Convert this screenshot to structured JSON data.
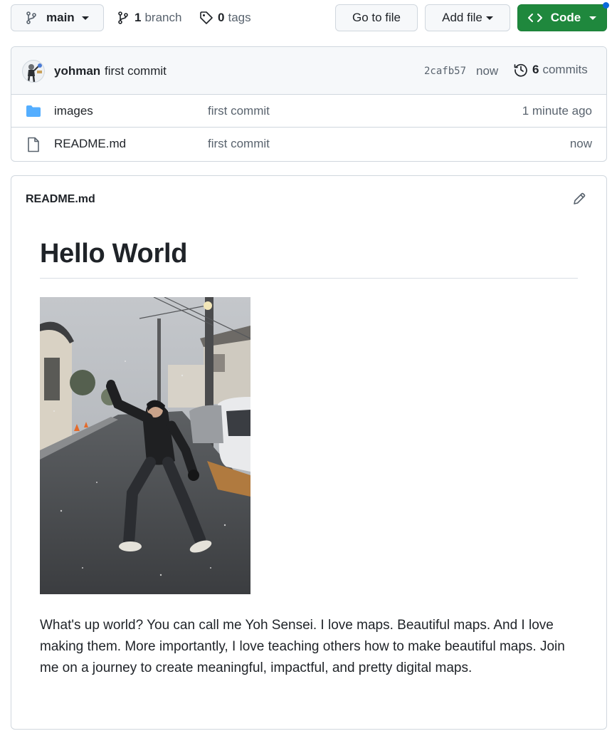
{
  "toolbar": {
    "branch_label": "main",
    "branch_count": "1",
    "branch_word": "branch",
    "tag_count": "0",
    "tag_word": "tags",
    "go_to_file": "Go to file",
    "add_file": "Add file",
    "code": "Code"
  },
  "commit": {
    "author": "yohman",
    "message": "first commit",
    "sha": "2cafb57",
    "time": "now",
    "count": "6",
    "count_word": "commits"
  },
  "files": [
    {
      "type": "folder",
      "name": "images",
      "message": "first commit",
      "age": "1 minute ago"
    },
    {
      "type": "file",
      "name": "README.md",
      "message": "first commit",
      "age": "now"
    }
  ],
  "readme": {
    "file_title": "README.md",
    "heading": "Hello World",
    "paragraph": "What's up world? You can call me Yoh Sensei. I love maps. Beautiful maps. And I love making them. More importantly, I love teaching others how to make beautiful maps. Join me on a journey to create meaningful, impactful, and pretty digital maps."
  },
  "colors": {
    "code_button": "#1f883d",
    "folder_icon": "#54aeff",
    "notification_dot": "#0969da"
  },
  "icons": [
    "branch-icon",
    "tag-icon",
    "code-icon",
    "history-icon",
    "folder-icon",
    "file-icon",
    "pencil-icon"
  ]
}
